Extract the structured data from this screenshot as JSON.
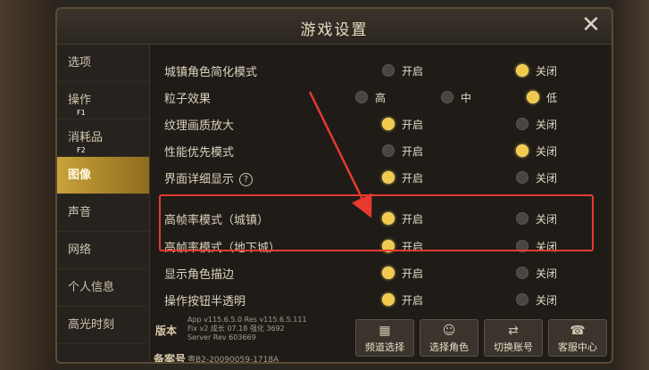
{
  "window": {
    "title": "游戏设置"
  },
  "sidebar": {
    "items": [
      {
        "label": "选项",
        "key": ""
      },
      {
        "label": "操作",
        "key": "F1"
      },
      {
        "label": "消耗品",
        "key": "F2"
      },
      {
        "label": "图像",
        "key": ""
      },
      {
        "label": "声音",
        "key": ""
      },
      {
        "label": "网络",
        "key": ""
      },
      {
        "label": "个人信息",
        "key": ""
      },
      {
        "label": "高光时刻",
        "key": ""
      }
    ]
  },
  "settings": {
    "rows": [
      {
        "label": "城镇角色简化模式",
        "options": [
          {
            "label": "开启",
            "selected": false
          },
          {
            "label": "关闭",
            "selected": true
          }
        ]
      },
      {
        "label": "粒子效果",
        "options": [
          {
            "label": "高",
            "selected": false
          },
          {
            "label": "中",
            "selected": false
          },
          {
            "label": "低",
            "selected": true
          }
        ]
      },
      {
        "label": "纹理画质放大",
        "options": [
          {
            "label": "开启",
            "selected": true
          },
          {
            "label": "关闭",
            "selected": false
          }
        ]
      },
      {
        "label": "性能优先模式",
        "options": [
          {
            "label": "开启",
            "selected": false
          },
          {
            "label": "关闭",
            "selected": true
          }
        ]
      },
      {
        "label": "界面详细显示",
        "options": [
          {
            "label": "开启",
            "selected": true
          },
          {
            "label": "关闭",
            "selected": false
          }
        ]
      },
      {
        "label": "高帧率模式（城镇）",
        "options": [
          {
            "label": "开启",
            "selected": true
          },
          {
            "label": "关闭",
            "selected": false
          }
        ]
      },
      {
        "label": "高帧率模式（地下城）",
        "options": [
          {
            "label": "开启",
            "selected": true
          },
          {
            "label": "关闭",
            "selected": false
          }
        ]
      },
      {
        "label": "显示角色描边",
        "options": [
          {
            "label": "开启",
            "selected": true
          },
          {
            "label": "关闭",
            "selected": false
          }
        ]
      },
      {
        "label": "操作按钮半透明",
        "options": [
          {
            "label": "开启",
            "selected": true
          },
          {
            "label": "关闭",
            "selected": false
          }
        ]
      }
    ]
  },
  "footer": {
    "version_label": "版本",
    "version_lines": [
      "App v115.6.5.0 Res v115.6.5.111",
      "Fix v2 成长 07.18 强化 3692",
      "Server Rev 603669"
    ],
    "registration_label": "备案号",
    "registration_text": "粤B2-20090059-1718A",
    "buttons": [
      {
        "label": "频道选择",
        "key": "G"
      },
      {
        "label": "选择角色",
        "key": "H"
      },
      {
        "label": "切换账号",
        "key": "W"
      },
      {
        "label": "客服中心",
        "key": "E"
      }
    ]
  },
  "colors": {
    "accent": "#f0c94d",
    "highlight": "#e63a2e",
    "active_tab": "#c9a23a"
  }
}
